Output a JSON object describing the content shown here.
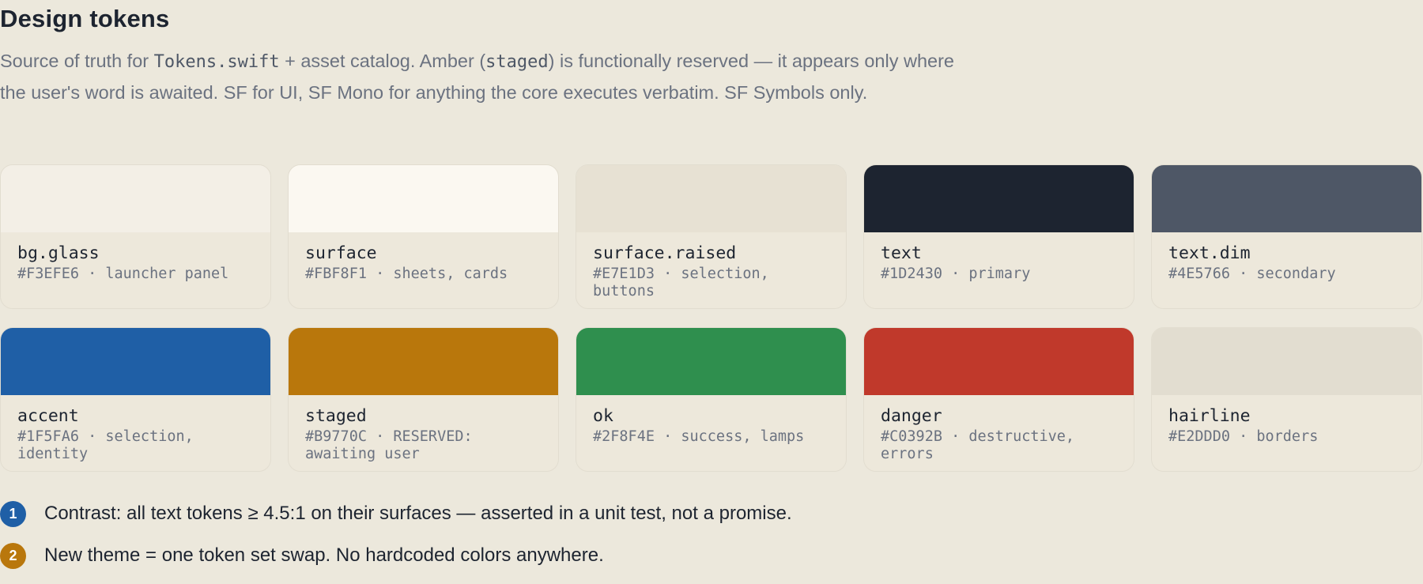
{
  "header": {
    "title": "Design tokens",
    "description": {
      "p1": "Source of truth for ",
      "code1": "Tokens.swift",
      "p2": " + asset catalog. Amber (",
      "code2": "staged",
      "p3": ") is functionally reserved — it appears only where the user's word is awaited. SF for UI, SF Mono for anything the core executes verbatim. SF Symbols only."
    }
  },
  "tokens": [
    {
      "name": "bg.glass",
      "description": "#F3EFE6 · launcher panel",
      "color": "#F3EFE6"
    },
    {
      "name": "surface",
      "description": "#FBF8F1 · sheets, cards",
      "color": "#FBF8F1"
    },
    {
      "name": "surface.raised",
      "description": "#E7E1D3 · selection, buttons",
      "color": "#E7E1D3"
    },
    {
      "name": "text",
      "description": "#1D2430 · primary",
      "color": "#1D2430"
    },
    {
      "name": "text.dim",
      "description": "#4E5766 · secondary",
      "color": "#4E5766"
    },
    {
      "name": "accent",
      "description": "#1F5FA6 · selection, identity",
      "color": "#1F5FA6"
    },
    {
      "name": "staged",
      "description": "#B9770C · RESERVED: awaiting user",
      "color": "#B9770C"
    },
    {
      "name": "ok",
      "description": "#2F8F4E · success, lamps",
      "color": "#2F8F4E"
    },
    {
      "name": "danger",
      "description": "#C0392B · destructive, errors",
      "color": "#C0392B"
    },
    {
      "name": "hairline",
      "description": "#E2DDD0 · borders",
      "color": "#E2DDD0"
    }
  ],
  "notes": [
    {
      "number": "1",
      "text": "Contrast: all text tokens ≥ 4.5:1 on their surfaces — asserted in a unit test, not a promise.",
      "badge_color": "#1F5FA6"
    },
    {
      "number": "2",
      "text": "New theme = one token set swap. No hardcoded colors anywhere.",
      "badge_color": "#B9770C"
    }
  ]
}
